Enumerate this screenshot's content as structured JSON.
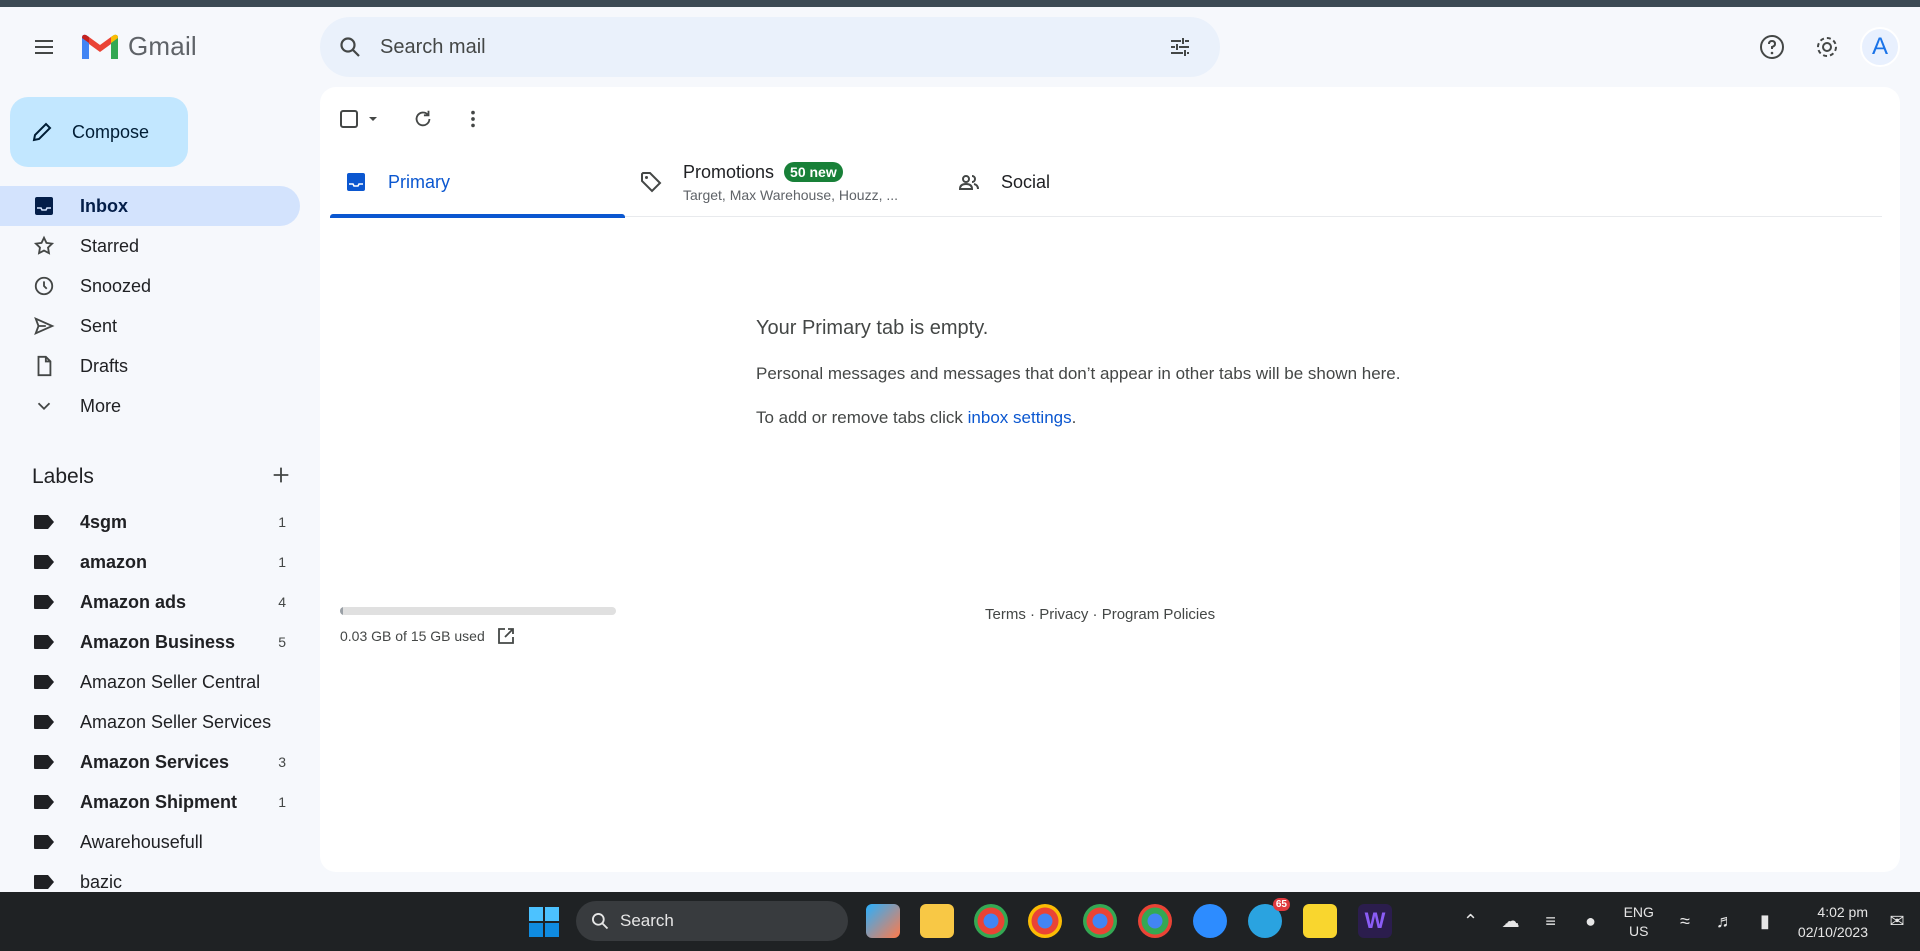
{
  "app": {
    "name": "Gmail"
  },
  "search": {
    "placeholder": "Search mail"
  },
  "header": {
    "avatar_letter": "A"
  },
  "sidebar": {
    "compose_label": "Compose",
    "nav": [
      {
        "label": "Inbox",
        "icon": "inbox-icon",
        "active": true
      },
      {
        "label": "Starred",
        "icon": "star-icon"
      },
      {
        "label": "Snoozed",
        "icon": "clock-icon"
      },
      {
        "label": "Sent",
        "icon": "send-icon"
      },
      {
        "label": "Drafts",
        "icon": "draft-icon"
      },
      {
        "label": "More",
        "icon": "chevron-down-icon"
      }
    ],
    "labels_title": "Labels",
    "labels": [
      {
        "name": "4sgm",
        "count": "1",
        "unread": true
      },
      {
        "name": "amazon",
        "count": "1",
        "unread": true
      },
      {
        "name": "Amazon ads",
        "count": "4",
        "unread": true
      },
      {
        "name": "Amazon Business",
        "count": "5",
        "unread": true
      },
      {
        "name": "Amazon Seller Central",
        "count": "",
        "unread": false
      },
      {
        "name": "Amazon Seller Services",
        "count": "",
        "unread": false
      },
      {
        "name": "Amazon Services",
        "count": "3",
        "unread": true
      },
      {
        "name": "Amazon Shipment",
        "count": "1",
        "unread": true
      },
      {
        "name": "Awarehousefull",
        "count": "",
        "unread": false
      },
      {
        "name": "bazic",
        "count": "",
        "unread": false
      }
    ]
  },
  "tabs": {
    "primary": "Primary",
    "promotions": "Promotions",
    "promotions_badge": "50 new",
    "promotions_sub": "Target, Max Warehouse, Houzz, ...",
    "social": "Social"
  },
  "empty_state": {
    "title": "Your Primary tab is empty.",
    "line1": "Personal messages and messages that don’t appear in other tabs will be shown here.",
    "line2_prefix": "To add or remove tabs click ",
    "line2_link": "inbox settings",
    "line2_suffix": "."
  },
  "storage": {
    "text": "0.03 GB of 15 GB used",
    "used_fraction": 0.002
  },
  "footer": {
    "terms": "Terms",
    "sep": " · ",
    "privacy": "Privacy",
    "policies": "Program Policies"
  },
  "taskbar": {
    "search_label": "Search",
    "lang_line1": "ENG",
    "lang_line2": "US",
    "time": "4:02 pm",
    "date": "02/10/2023",
    "telegram_badge": "65"
  },
  "colors": {
    "accent": "#0b57d0",
    "compose_bg": "#c2e7ff",
    "active_nav_bg": "#d3e3fd",
    "badge_green": "#188038"
  }
}
